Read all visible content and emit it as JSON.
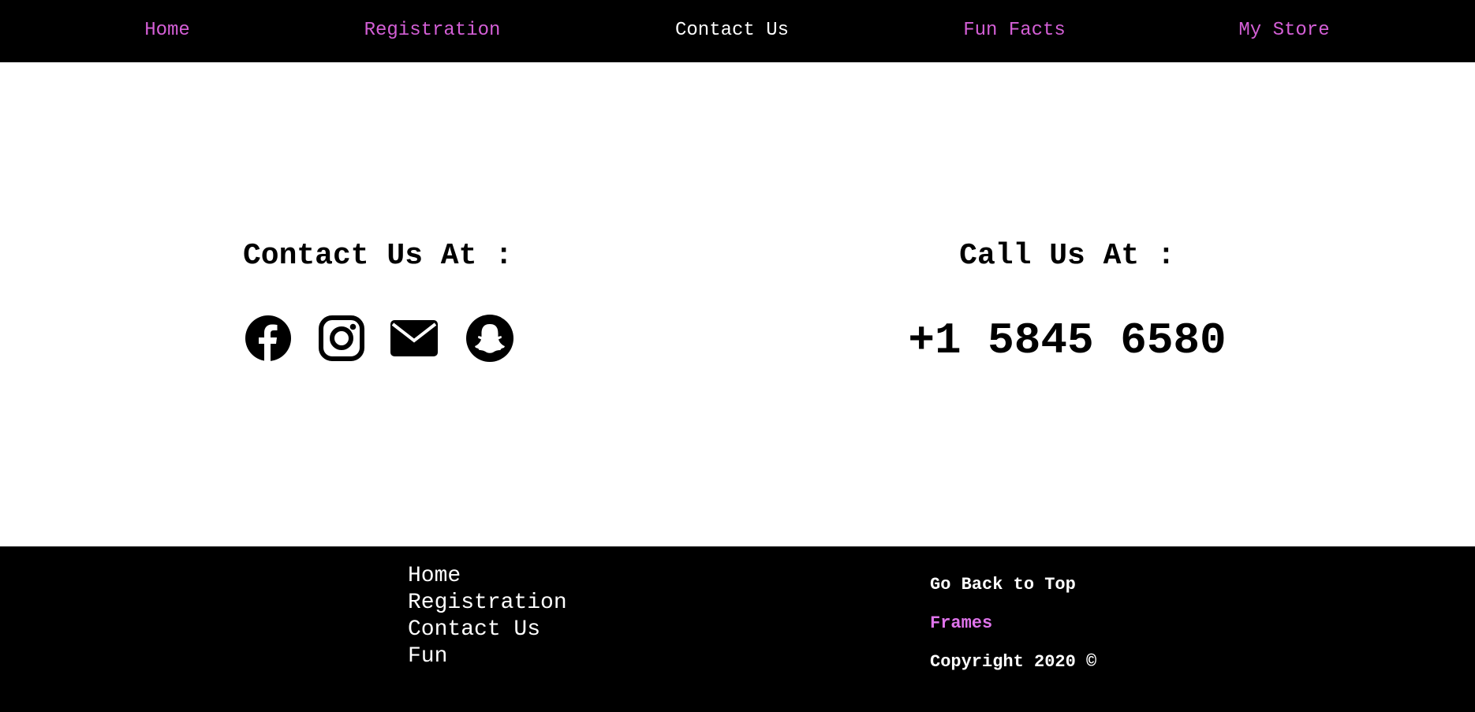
{
  "nav": {
    "items": [
      {
        "label": "Home",
        "active": false
      },
      {
        "label": "Registration",
        "active": false
      },
      {
        "label": "Contact Us",
        "active": true
      },
      {
        "label": "Fun Facts",
        "active": false
      },
      {
        "label": "My Store",
        "active": false
      }
    ]
  },
  "contact": {
    "title": "Contact Us At :",
    "icons": [
      "facebook-icon",
      "instagram-icon",
      "envelope-icon",
      "snapchat-icon"
    ]
  },
  "call": {
    "title": "Call Us At :",
    "phone": "+1 5845 6580"
  },
  "footer": {
    "links": [
      "Home",
      "Registration",
      "Contact Us",
      "Fun"
    ],
    "back_to_top": "Go Back to Top",
    "frames": "Frames",
    "copyright": "Copyright 2020 ©"
  },
  "colors": {
    "nav_bg": "#000000",
    "nav_link": "#d45fd6",
    "nav_active": "#ffffff",
    "frames_link": "#e074ec"
  }
}
